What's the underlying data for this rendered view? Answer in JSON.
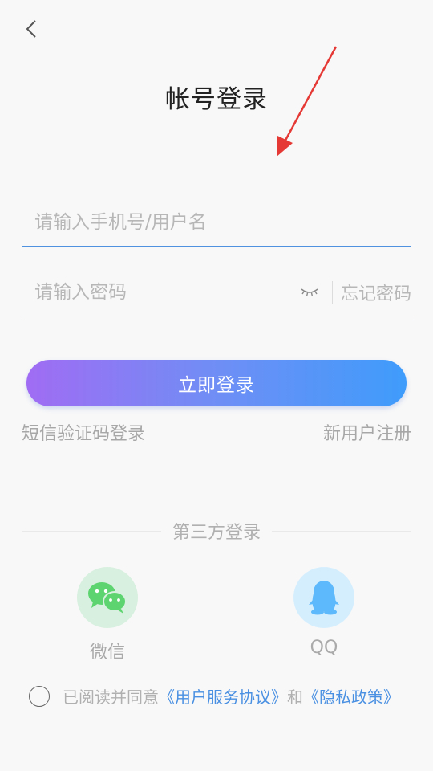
{
  "header": {
    "title": "帐号登录",
    "back_icon": "chevron-left-icon"
  },
  "form": {
    "username_placeholder": "请输入手机号/用户名",
    "password_placeholder": "请输入密码",
    "eye_icon": "eye-closed-icon",
    "forgot_password": "忘记密码"
  },
  "actions": {
    "login_label": "立即登录",
    "sms_login": "短信验证码登录",
    "register": "新用户注册"
  },
  "third_party": {
    "label": "第三方登录",
    "wechat": {
      "name": "微信",
      "icon": "wechat-icon",
      "color": "#5dd46f"
    },
    "qq": {
      "name": "QQ",
      "icon": "qq-icon",
      "color": "#5db9fb"
    }
  },
  "agreement": {
    "prefix": "已阅读并同意",
    "service_link": "《用户服务协议》",
    "and": "和",
    "privacy_link": "《隐私政策》"
  },
  "colors": {
    "accent": "#4a90e2",
    "gradient_start": "#a06cf3",
    "gradient_end": "#3f9cfb",
    "annotation_arrow": "#e53935"
  }
}
